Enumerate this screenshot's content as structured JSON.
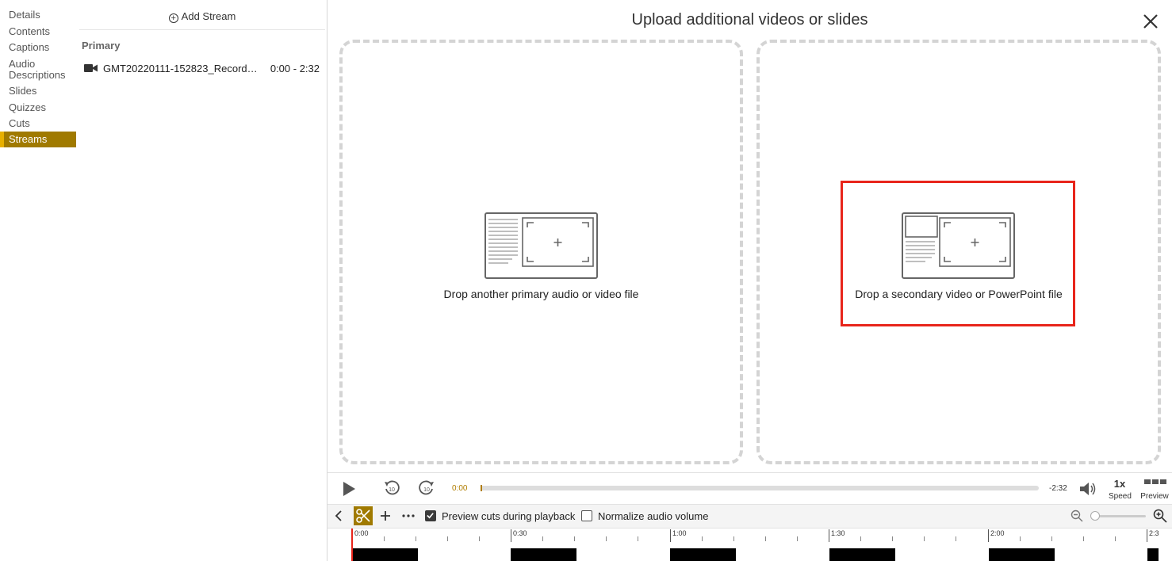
{
  "nav": {
    "items": [
      "Details",
      "Contents",
      "Captions",
      "Audio\nDescriptions",
      "Slides",
      "Quizzes",
      "Cuts",
      "Streams"
    ],
    "active": "Streams"
  },
  "streams": {
    "add_label": "Add Stream",
    "section_label": "Primary",
    "items": [
      {
        "name": "GMT20220111-152823_Recordi...",
        "range": "0:00 - 2:32",
        "icon": "video-camera-icon"
      }
    ]
  },
  "upload": {
    "title": "Upload additional videos or slides",
    "primary_drop": "Drop another primary audio or video file",
    "secondary_drop": "Drop a secondary video or PowerPoint file"
  },
  "player": {
    "current_time": "0:00",
    "remaining_time": "-2:32",
    "speed_value": "1x",
    "speed_label": "Speed",
    "preview_label": "Preview",
    "progress": 0
  },
  "toolbar": {
    "preview_cuts_label": "Preview cuts during playback",
    "preview_cuts_checked": true,
    "normalize_label": "Normalize audio volume",
    "normalize_checked": false
  },
  "timeline": {
    "ticks": [
      "0:00",
      "0:30",
      "1:00",
      "1:30",
      "2:00",
      "2:3"
    ]
  },
  "colors": {
    "accent": "#a07a00",
    "highlight": "#e8251b"
  }
}
